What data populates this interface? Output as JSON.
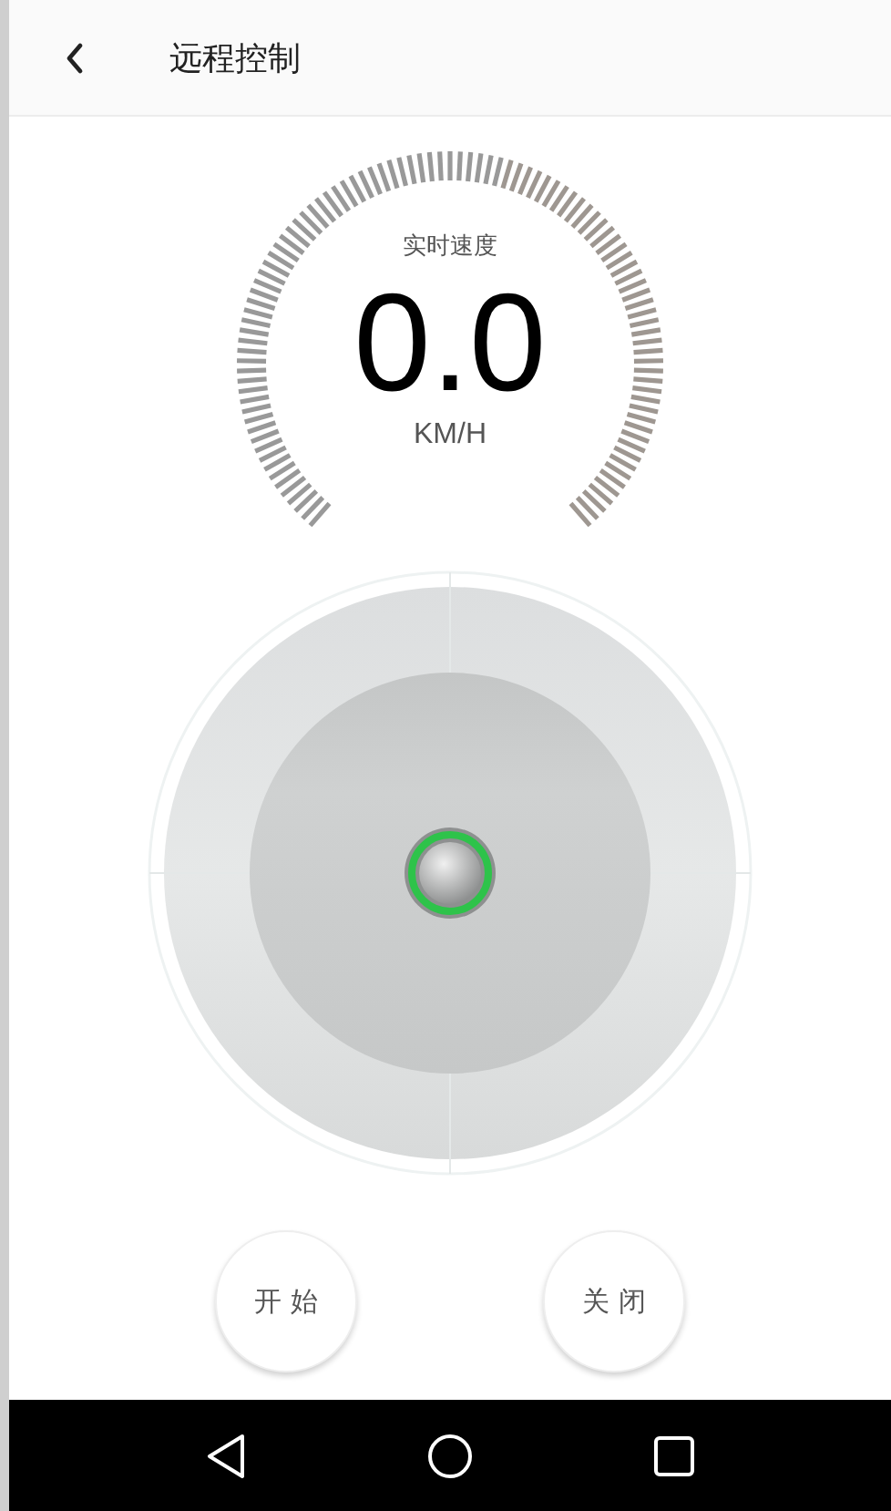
{
  "header": {
    "title": "远程控制"
  },
  "speedometer": {
    "label": "实时速度",
    "value": "0.0",
    "unit": "KM/H"
  },
  "buttons": [
    {
      "label": "开 始"
    },
    {
      "label": "关 闭"
    }
  ]
}
